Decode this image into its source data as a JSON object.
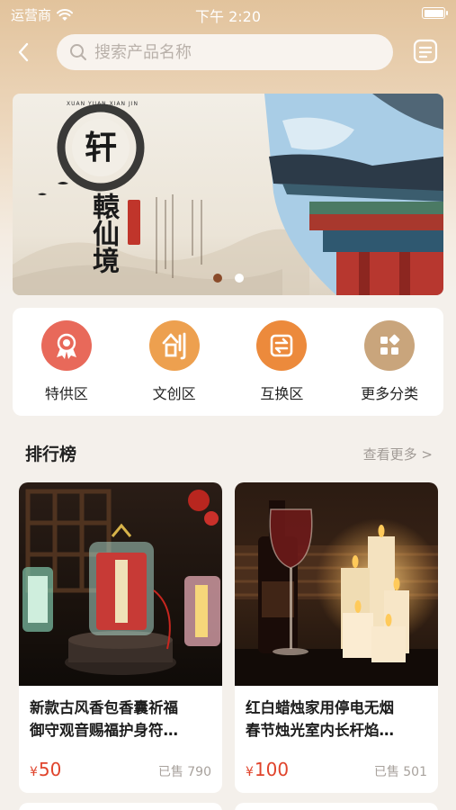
{
  "status_bar": {
    "carrier": "运营商",
    "time": "下午 2:20"
  },
  "search": {
    "placeholder": "搜索产品名称"
  },
  "banner": {
    "emblem_char": "轩",
    "emblem_pinyin": "XUAN YUAN XIAN JIN",
    "brand_name": "轅仙境",
    "slide_count": 2,
    "active_slide": 0
  },
  "categories": [
    {
      "label": "特供区",
      "icon": "award-ribbon-icon",
      "color": "#e8695a"
    },
    {
      "label": "文创区",
      "icon": "chuang-character-icon",
      "color": "#eda04f"
    },
    {
      "label": "互换区",
      "icon": "exchange-arrows-icon",
      "color": "#ec8a3c"
    },
    {
      "label": "更多分类",
      "icon": "grid-more-icon",
      "color": "#c9a57c"
    }
  ],
  "ranking": {
    "title": "排行榜",
    "see_more": "查看更多 >",
    "products": [
      {
        "name_line1": "新款古风香包香囊祈福",
        "name_line2": "御守观音赐福护身符…",
        "currency": "¥",
        "price": "50",
        "sold": "已售 790"
      },
      {
        "name_line1": "红白蜡烛家用停电无烟",
        "name_line2": "春节烛光室内长杆焰…",
        "currency": "¥",
        "price": "100",
        "sold": "已售 501"
      }
    ]
  },
  "colors": {
    "accent": "#e0442c",
    "brand_brown": "#8a4b2a"
  }
}
